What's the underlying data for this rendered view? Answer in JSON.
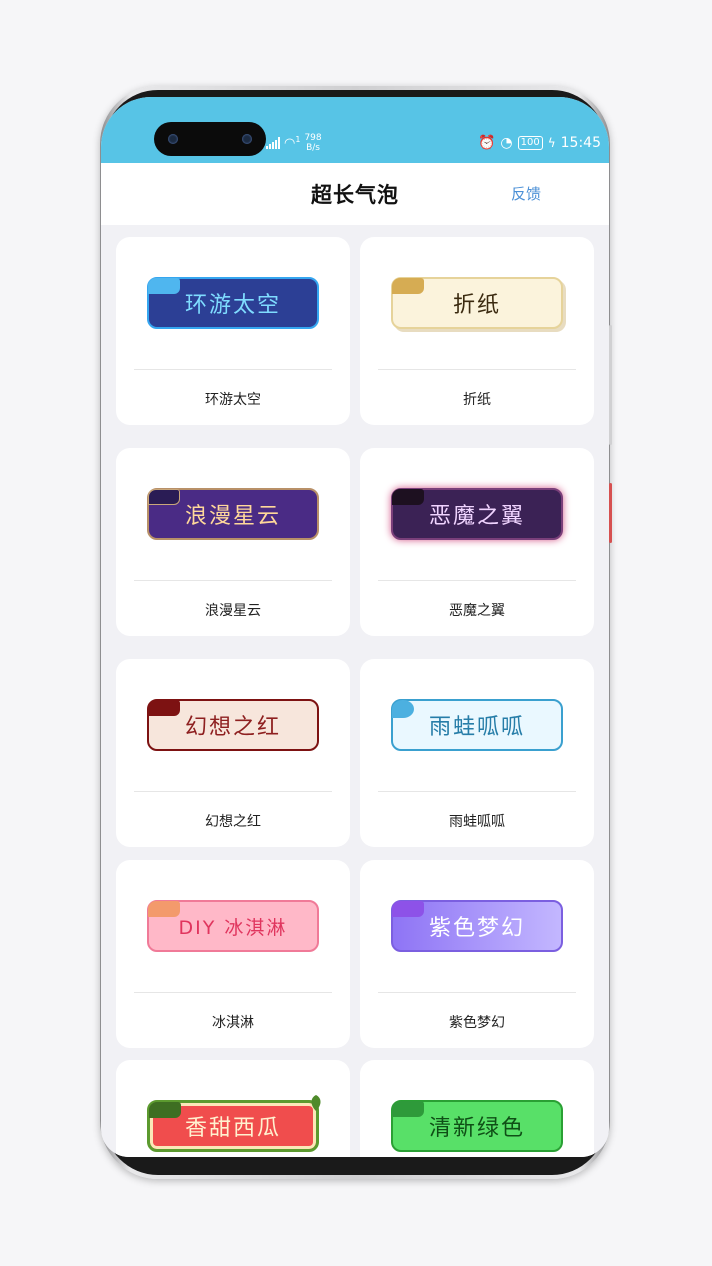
{
  "status_bar": {
    "net_speed_value": "798",
    "net_speed_unit": "B/s",
    "wifi_badge": "1",
    "battery": "100",
    "time": "15:45"
  },
  "header": {
    "title": "超长气泡",
    "feedback": "反馈"
  },
  "bubbles": [
    {
      "bubble_text": "环游太空",
      "label": "环游太空"
    },
    {
      "bubble_text": "折纸",
      "label": "折纸"
    },
    {
      "bubble_text": "浪漫星云",
      "label": "浪漫星云"
    },
    {
      "bubble_text": "恶魔之翼",
      "label": "恶魔之翼"
    },
    {
      "bubble_text": "幻想之红",
      "label": "幻想之红"
    },
    {
      "bubble_text": "雨蛙呱呱",
      "label": "雨蛙呱呱"
    },
    {
      "bubble_text": "DIY 冰淇淋",
      "label": "冰淇淋"
    },
    {
      "bubble_text": "紫色梦幻",
      "label": "紫色梦幻"
    },
    {
      "bubble_text": "香甜西瓜",
      "label": ""
    },
    {
      "bubble_text": "清新绿色",
      "label": ""
    }
  ],
  "colors": {
    "status_bar": "#57c4e6",
    "accent_link": "#4a8fd6",
    "page_background": "#f1f1f5"
  }
}
